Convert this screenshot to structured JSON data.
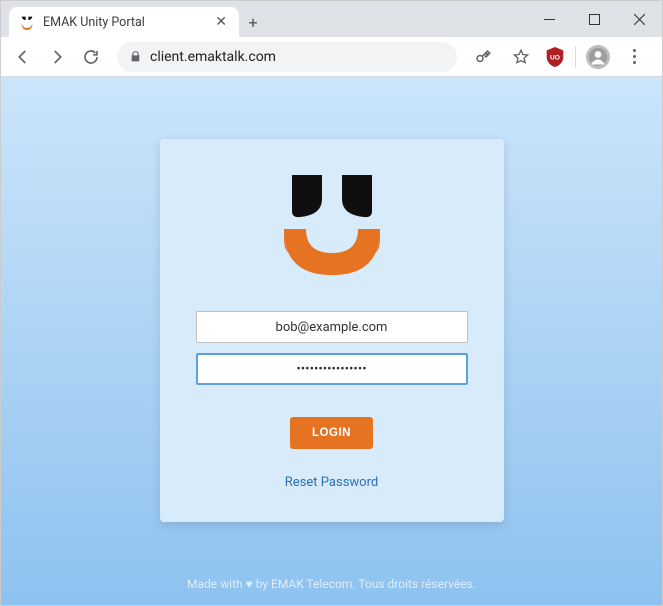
{
  "browser": {
    "tab_title": "EMAK Unity Portal",
    "url": "client.emaktalk.com",
    "ext_label": "UO"
  },
  "login": {
    "email_value": "bob@example.com",
    "password_value": "••••••••••••••••",
    "login_button": "LOGIN",
    "reset_link": "Reset Password"
  },
  "footer": {
    "text_prefix": "Made with ",
    "heart": "♥",
    "text_suffix": " by EMAK Telecom. Tous droits réservées."
  },
  "colors": {
    "accent": "#e67321",
    "link": "#2c6fb5"
  }
}
